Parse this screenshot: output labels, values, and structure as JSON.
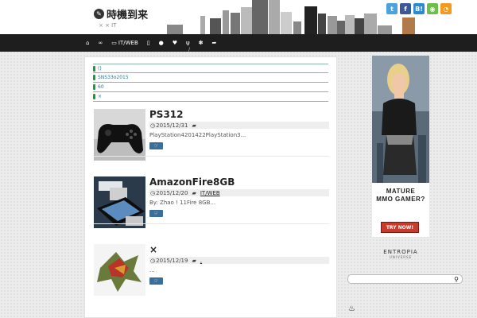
{
  "header": {
    "site_title": "時機到来",
    "tagline": "× × IT",
    "social": [
      {
        "icon": "twitter-icon",
        "glyph": "t",
        "color": "#4aa3df"
      },
      {
        "icon": "facebook-icon",
        "glyph": "f",
        "color": "#3b5998"
      },
      {
        "icon": "hatena-icon",
        "glyph": "B!",
        "color": "#2a8bd0"
      },
      {
        "icon": "feedly-icon",
        "glyph": "◉",
        "color": "#6cc04a"
      },
      {
        "icon": "rss-icon",
        "glyph": "◔",
        "color": "#f39a1e"
      }
    ]
  },
  "nav": {
    "items": [
      {
        "icon": "home-icon",
        "glyph": "⌂",
        "label": ""
      },
      {
        "icon": "infinity-icon",
        "glyph": "∞",
        "label": ""
      },
      {
        "icon": "laptop-icon",
        "glyph": "▭",
        "label": "IT/WEB"
      },
      {
        "icon": "mobile-icon",
        "glyph": "▯",
        "label": ""
      },
      {
        "icon": "user-icon",
        "glyph": "●",
        "label": ""
      },
      {
        "icon": "heart-icon",
        "glyph": "♥",
        "label": ""
      },
      {
        "icon": "fork-icon",
        "glyph": "ψ",
        "label": "",
        "sub": "/"
      },
      {
        "icon": "paw-icon",
        "glyph": "✽",
        "label": ""
      },
      {
        "icon": "share-icon",
        "glyph": "➦",
        "label": ""
      }
    ]
  },
  "notices": [
    "()",
    "SNS33o2015",
    "60",
    "×"
  ],
  "posts": [
    {
      "title": "PS312",
      "date": "2015/12/31",
      "category": "",
      "excerpt": "PlayStation4201422PlayStation3..."
    },
    {
      "title": "AmazonFire8GB",
      "date": "2015/12/20",
      "category": "IT/WEB",
      "excerpt": "By: Zhao ! 11Fire  8GB..."
    },
    {
      "title": "×",
      "date": "2015/12/19",
      "category": ",",
      "excerpt": "..."
    }
  ],
  "sidebar": {
    "ad_text": "MATURE\nMMO GAMER?",
    "ad_button": "TRY NOW!",
    "brand": "ENTROPIA",
    "brand_sub": "UNIVERSE",
    "search_placeholder": ""
  }
}
